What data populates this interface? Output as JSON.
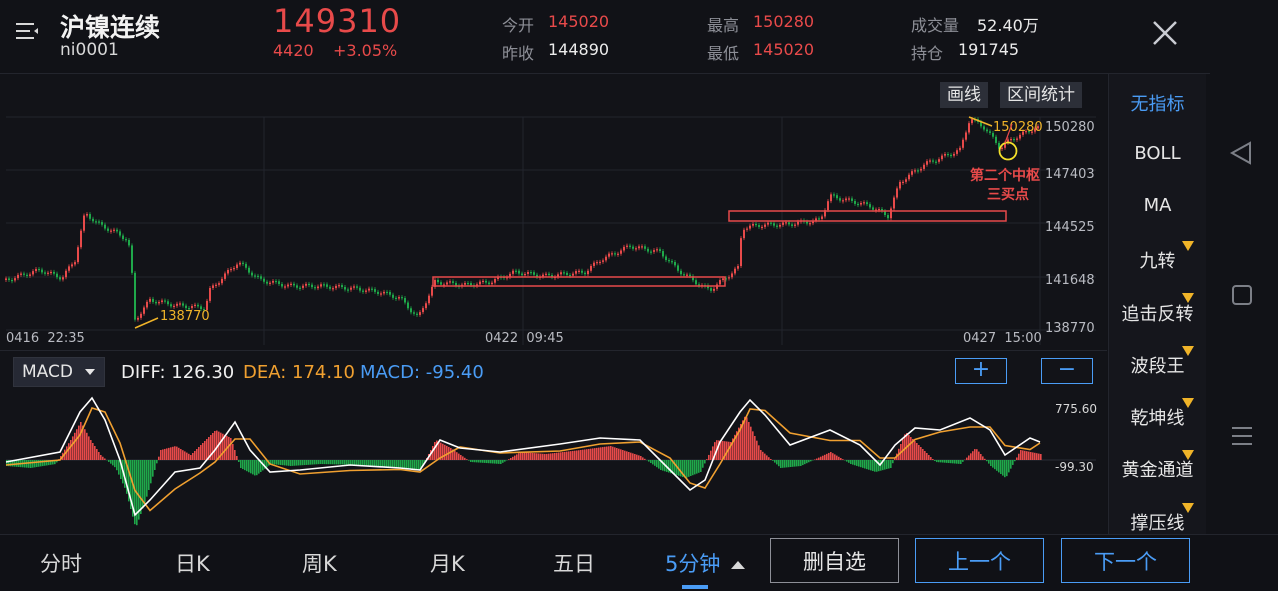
{
  "header": {
    "title": "沪镍连续",
    "code": "ni0001",
    "price": "149310",
    "change": "4420",
    "change_pct": "+3.05%",
    "open_label": "今开",
    "open_value": "145020",
    "prev_close_label": "昨收",
    "prev_close_value": "144890",
    "high_label": "最高",
    "high_value": "150280",
    "low_label": "最低",
    "low_value": "145020",
    "volume_label": "成交量",
    "volume_value": "52.40万",
    "oi_label": "持仓",
    "oi_value": "191745"
  },
  "toolbar": {
    "draw_label": "画线",
    "range_stats_label": "区间统计"
  },
  "chart": {
    "y_ticks": [
      "150280",
      "147403",
      "144525",
      "141648",
      "138770"
    ],
    "x_ticks": [
      "0416  22:35",
      "0422  09:45",
      "0427  15:00"
    ],
    "low_marker": "138770",
    "high_marker": "150280",
    "annotation_line1": "第二个中枢",
    "annotation_line2": "三买点"
  },
  "macd": {
    "selector": "MACD",
    "diff": "DIFF: 126.30",
    "dea": "DEA: 174.10",
    "macd": "MACD: -95.40",
    "plus": "+",
    "minus": "−",
    "y_top": "775.60",
    "y_bottom": "-99.30"
  },
  "indicators": [
    "无指标",
    "BOLL",
    "MA",
    "九转",
    "追击反转",
    "波段王",
    "乾坤线",
    "黄金通道",
    "撑压线"
  ],
  "tabs": [
    "分时",
    "日K",
    "周K",
    "月K",
    "五日",
    "5分钟"
  ],
  "buttons": {
    "watchlist": "删自选",
    "prev": "上一个",
    "next": "下一个"
  },
  "colors": {
    "up": "#e84a4a",
    "down": "#1fa84a",
    "accent": "#4a9cf5",
    "marker": "#f0b429",
    "diff_line": "#ffffff",
    "dea_line": "#f0a030"
  }
}
